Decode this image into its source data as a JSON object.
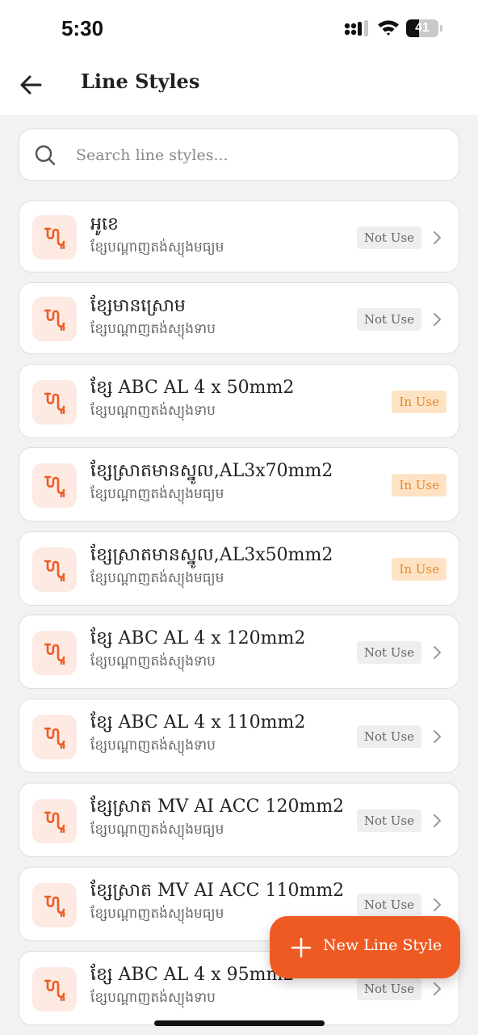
{
  "status_bar": {
    "time": "5:30",
    "battery_level": "41",
    "battery_fraction": 0.41
  },
  "header": {
    "title": "Line Styles",
    "back_icon": "arrow-left-icon"
  },
  "search": {
    "placeholder": "Search line styles...",
    "value": "",
    "icon": "search-icon"
  },
  "colors": {
    "accent": "#ef5a23",
    "icon_bg": "#fdeae3",
    "in_use_bg": "#fde3c4",
    "in_use_text": "#e08a2b",
    "not_use_bg": "#eeeeee"
  },
  "line_styles": [
    {
      "title": "អូខេ",
      "subtitle": "ខ្សែបណ្ដាញតង់ស្យុងមធ្យម",
      "status": "Not Use"
    },
    {
      "title": "ខ្សែមានស្រោម",
      "subtitle": "ខ្សែបណ្ដាញតង់ស្យុងទាប",
      "status": "Not Use"
    },
    {
      "title": "ខ្សែ ABC AL 4 x 50mm2",
      "subtitle": "ខ្សែបណ្ដាញតង់ស្យុងទាប",
      "status": "In Use"
    },
    {
      "title": "ខ្សែស្រាតមានស្នូល,AL3x70mm2",
      "subtitle": "ខ្សែបណ្ដាញតង់ស្យុងមធ្យម",
      "status": "In Use"
    },
    {
      "title": "ខ្សែស្រាតមានស្នូល,AL3x50mm2",
      "subtitle": "ខ្សែបណ្ដាញតង់ស្យុងមធ្យម",
      "status": "In Use"
    },
    {
      "title": "ខ្សែ ABC AL 4 x 120mm2",
      "subtitle": "ខ្សែបណ្ដាញតង់ស្យុងទាប",
      "status": "Not Use"
    },
    {
      "title": "ខ្សែ ABC AL 4 x 110mm2",
      "subtitle": "ខ្សែបណ្ដាញតង់ស្យុងទាប",
      "status": "Not Use"
    },
    {
      "title": "ខ្សែស្រាត MV AI ACC 120mm2",
      "subtitle": "ខ្សែបណ្ដាញតង់ស្យុងមធ្យម",
      "status": "Not Use"
    },
    {
      "title": "ខ្សែស្រាត MV AI ACC 110mm2",
      "subtitle": "ខ្សែបណ្ដាញតង់ស្យុងមធ្យម",
      "status": "Not Use"
    },
    {
      "title": "ខ្សែ ABC AL 4 x 95mm2",
      "subtitle": "ខ្សែបណ្ដាញតង់ស្យុងទាប",
      "status": "Not Use"
    }
  ],
  "fab": {
    "label": "New Line Style",
    "icon": "plus-icon"
  }
}
